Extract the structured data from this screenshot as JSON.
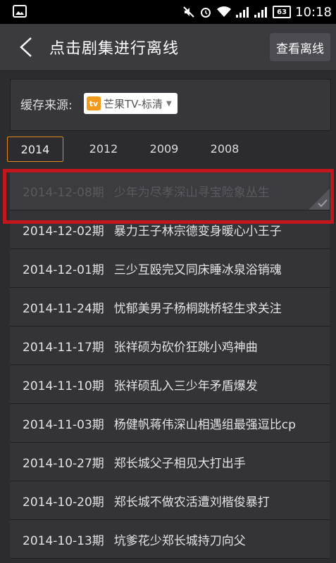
{
  "status_bar": {
    "time": "10:18",
    "battery": "63"
  },
  "header": {
    "title": "点击剧集进行离线",
    "view_offline": "查看离线"
  },
  "source": {
    "label": "缓存来源:",
    "selected": "芒果TV-标清"
  },
  "years": [
    "2014",
    "2012",
    "2009",
    "2008"
  ],
  "episodes": [
    {
      "date": "2014-12-08期",
      "title": "少年为尽孝深山寻宝险象丛生"
    },
    {
      "date": "2014-12-02期",
      "title": "暴力王子林宗德变身暖心小王子"
    },
    {
      "date": "2014-12-01期",
      "title": "三少互殴完又同床睡冰泉浴销魂"
    },
    {
      "date": "2014-11-24期",
      "title": "忧郁美男子杨桐跳桥轻生求关注"
    },
    {
      "date": "2014-11-17期",
      "title": "张祥硕为砍价狂跳小鸡神曲"
    },
    {
      "date": "2014-11-10期",
      "title": "张祥硕乱入三少年矛盾爆发"
    },
    {
      "date": "2014-11-03期",
      "title": "杨健帆蒋伟深山相遇组最强逗比cp"
    },
    {
      "date": "2014-10-27期",
      "title": "郑长城父子相见大打出手"
    },
    {
      "date": "2014-10-20期",
      "title": "郑长城不做农活遭刘楷俊暴打"
    },
    {
      "date": "2014-10-13期",
      "title": "坑爹花少郑长城持刀向父"
    }
  ],
  "colors": {
    "accent": "#e08a1a",
    "highlight": "#c0161c"
  }
}
